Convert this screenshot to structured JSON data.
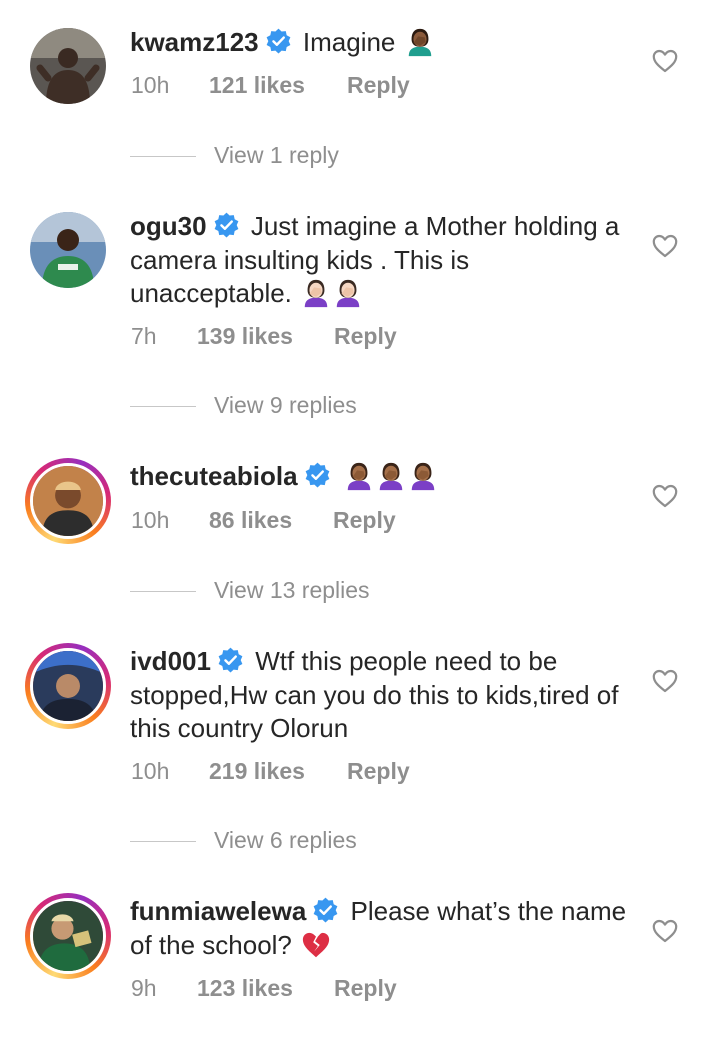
{
  "comments": [
    {
      "username": "kwamz123",
      "text": "Imagine",
      "time": "10h",
      "likes": "121 likes",
      "reply": "Reply",
      "view_replies": "View 1 reply",
      "story_ring": false
    },
    {
      "username": "ogu30",
      "text": "Just imagine a Mother holding a camera insulting kids . This is unacceptable.",
      "time": "7h",
      "likes": "139 likes",
      "reply": "Reply",
      "view_replies": "View 9 replies",
      "story_ring": false
    },
    {
      "username": "thecuteabiola",
      "text": "",
      "time": "10h",
      "likes": "86 likes",
      "reply": "Reply",
      "view_replies": "View 13 replies",
      "story_ring": true
    },
    {
      "username": "ivd001",
      "text": "Wtf this people need to be stopped,Hw can you do this to kids,tired of this country Olorun",
      "time": "10h",
      "likes": "219 likes",
      "reply": "Reply",
      "view_replies": "View 6 replies",
      "story_ring": true
    },
    {
      "username": "funmiawelewa",
      "text": "Please what’s the name of the school?",
      "time": "9h",
      "likes": "123 likes",
      "reply": "Reply",
      "story_ring": true
    }
  ],
  "colors": {
    "verified": "#3897f0",
    "text": "#262626",
    "muted": "#8e8e8e"
  },
  "icons": [
    "verified-badge-icon",
    "heart-outline-icon",
    "facepalm-emoji",
    "broken-heart-emoji"
  ]
}
